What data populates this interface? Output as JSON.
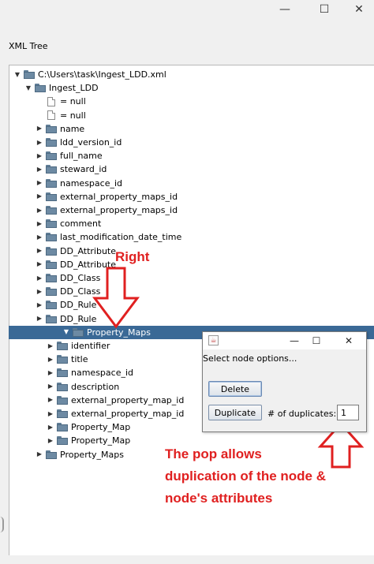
{
  "window": {
    "minimize_glyph": "—",
    "maximize_glyph": "☐",
    "close_glyph": "✕"
  },
  "panel": {
    "title": "XML Tree"
  },
  "tree": {
    "nodes": [
      {
        "label": "C:\\Users\\task\\Ingest_LDD.xml",
        "type": "folder",
        "expander": "expanded"
      },
      {
        "label": "Ingest_LDD",
        "type": "folder",
        "expander": "expanded"
      },
      {
        "label": "= null",
        "type": "file",
        "expander": "none"
      },
      {
        "label": "= null",
        "type": "file",
        "expander": "none"
      },
      {
        "label": "name",
        "type": "folder",
        "expander": "collapsed"
      },
      {
        "label": "ldd_version_id",
        "type": "folder",
        "expander": "collapsed"
      },
      {
        "label": "full_name",
        "type": "folder",
        "expander": "collapsed"
      },
      {
        "label": "steward_id",
        "type": "folder",
        "expander": "collapsed"
      },
      {
        "label": "namespace_id",
        "type": "folder",
        "expander": "collapsed"
      },
      {
        "label": "external_property_maps_id",
        "type": "folder",
        "expander": "collapsed"
      },
      {
        "label": "external_property_maps_id",
        "type": "folder",
        "expander": "collapsed"
      },
      {
        "label": "comment",
        "type": "folder",
        "expander": "collapsed"
      },
      {
        "label": "last_modification_date_time",
        "type": "folder",
        "expander": "collapsed"
      },
      {
        "label": "DD_Attribute",
        "type": "folder",
        "expander": "collapsed"
      },
      {
        "label": "DD_Attribute",
        "type": "folder",
        "expander": "collapsed"
      },
      {
        "label": "DD_Class",
        "type": "folder",
        "expander": "collapsed"
      },
      {
        "label": "DD_Class",
        "type": "folder",
        "expander": "collapsed"
      },
      {
        "label": "DD_Rule",
        "type": "folder",
        "expander": "collapsed"
      },
      {
        "label": "DD_Rule",
        "type": "folder",
        "expander": "collapsed"
      },
      {
        "label": "Property_Maps",
        "type": "folder",
        "expander": "expanded",
        "selected": true
      },
      {
        "label": "identifier",
        "type": "folder",
        "expander": "collapsed"
      },
      {
        "label": "title",
        "type": "folder",
        "expander": "collapsed"
      },
      {
        "label": "namespace_id",
        "type": "folder",
        "expander": "collapsed"
      },
      {
        "label": "description",
        "type": "folder",
        "expander": "collapsed"
      },
      {
        "label": "external_property_map_id",
        "type": "folder",
        "expander": "collapsed"
      },
      {
        "label": "external_property_map_id",
        "type": "folder",
        "expander": "collapsed"
      },
      {
        "label": "Property_Map",
        "type": "folder",
        "expander": "collapsed"
      },
      {
        "label": "Property_Map",
        "type": "folder",
        "expander": "collapsed"
      },
      {
        "label": "Property_Maps",
        "type": "folder",
        "expander": "collapsed"
      }
    ]
  },
  "dialog": {
    "minimize_glyph": "—",
    "maximize_glyph": "☐",
    "close_glyph": "✕",
    "message": "Select node options...",
    "delete_label": "Delete",
    "duplicate_label": "Duplicate",
    "duplicates_label": "# of duplicates:",
    "duplicates_value": "1"
  },
  "annotations": {
    "right_text": "Right",
    "pop_line1": "The pop allows",
    "pop_line2": "duplication of the node &",
    "pop_line3": "node's attributes",
    "color": "#e02020"
  },
  "colors": {
    "selection": "#3a6996",
    "folder": "#6d8aa3"
  }
}
